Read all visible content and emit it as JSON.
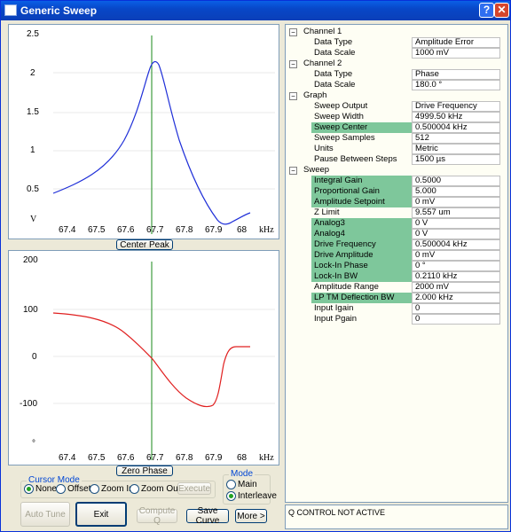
{
  "window": {
    "title": "Generic Sweep",
    "help": "?",
    "close": "✕"
  },
  "graph1": {
    "y_ticks": [
      "2.5",
      "2",
      "1.5",
      "1",
      "0.5",
      "V"
    ],
    "x_ticks": [
      "67.4",
      "67.5",
      "67.6",
      "67.7",
      "67.8",
      "67.9",
      "68"
    ],
    "x_unit": "kHz",
    "button": "Center Peak",
    "line_color": "#1f2fd8"
  },
  "graph2": {
    "y_ticks": [
      "200",
      "100",
      "0",
      "-100",
      "°"
    ],
    "x_ticks": [
      "67.4",
      "67.5",
      "67.6",
      "67.7",
      "67.8",
      "67.9",
      "68"
    ],
    "x_unit": "kHz",
    "button": "Zero Phase",
    "line_color": "#e02020"
  },
  "cursor_mode": {
    "title": "Cursor Mode",
    "options": [
      "None",
      "Offset",
      "Zoom In",
      "Zoom Out"
    ],
    "selected": "None",
    "execute": "Execute"
  },
  "mode": {
    "title": "Mode",
    "options": [
      "Main",
      "Interleave"
    ],
    "selected": "Interleave"
  },
  "buttons": {
    "auto_tune": "Auto Tune",
    "exit": "Exit",
    "compute_q": "Compute Q",
    "save_curve": "Save Curve",
    "more": "More >"
  },
  "tree": {
    "channel1": {
      "label": "Channel 1",
      "rows": [
        {
          "label": "Data Type",
          "value": "Amplitude Error"
        },
        {
          "label": "Data Scale",
          "value": "1000 mV"
        }
      ]
    },
    "channel2": {
      "label": "Channel 2",
      "rows": [
        {
          "label": "Data Type",
          "value": "Phase"
        },
        {
          "label": "Data Scale",
          "value": "180.0 °"
        }
      ]
    },
    "graph": {
      "label": "Graph",
      "rows": [
        {
          "label": "Sweep Output",
          "value": "Drive Frequency"
        },
        {
          "label": "Sweep Width",
          "value": "4999.50 kHz"
        },
        {
          "label": "Sweep Center",
          "value": "0.500004 kHz"
        },
        {
          "label": "Sweep Samples",
          "value": "512"
        },
        {
          "label": "Units",
          "value": "Metric"
        },
        {
          "label": "Pause Between Steps",
          "value": "1500 µs"
        }
      ]
    },
    "sweep": {
      "label": "Sweep",
      "rows": [
        {
          "label": "Integral Gain",
          "value": "0.5000"
        },
        {
          "label": "Proportional Gain",
          "value": "5.000"
        },
        {
          "label": "Amplitude Setpoint",
          "value": "0 mV"
        },
        {
          "label": "Z Limit",
          "value": "9.557 um"
        },
        {
          "label": "Analog3",
          "value": "0 V"
        },
        {
          "label": "Analog4",
          "value": "0 V"
        },
        {
          "label": "Drive Frequency",
          "value": "0.500004 kHz"
        },
        {
          "label": "Drive Amplitude",
          "value": "0 mV"
        },
        {
          "label": "Lock-In Phase",
          "value": "0 °"
        },
        {
          "label": "Lock-In BW",
          "value": "0.2110 kHz"
        },
        {
          "label": "Amplitude Range",
          "value": "2000 mV"
        },
        {
          "label": "LP TM Deflection BW",
          "value": "2.000 kHz"
        },
        {
          "label": "Input Igain",
          "value": "0"
        },
        {
          "label": "Input Pgain",
          "value": "0"
        }
      ]
    }
  },
  "status": "Q CONTROL NOT ACTIVE"
}
